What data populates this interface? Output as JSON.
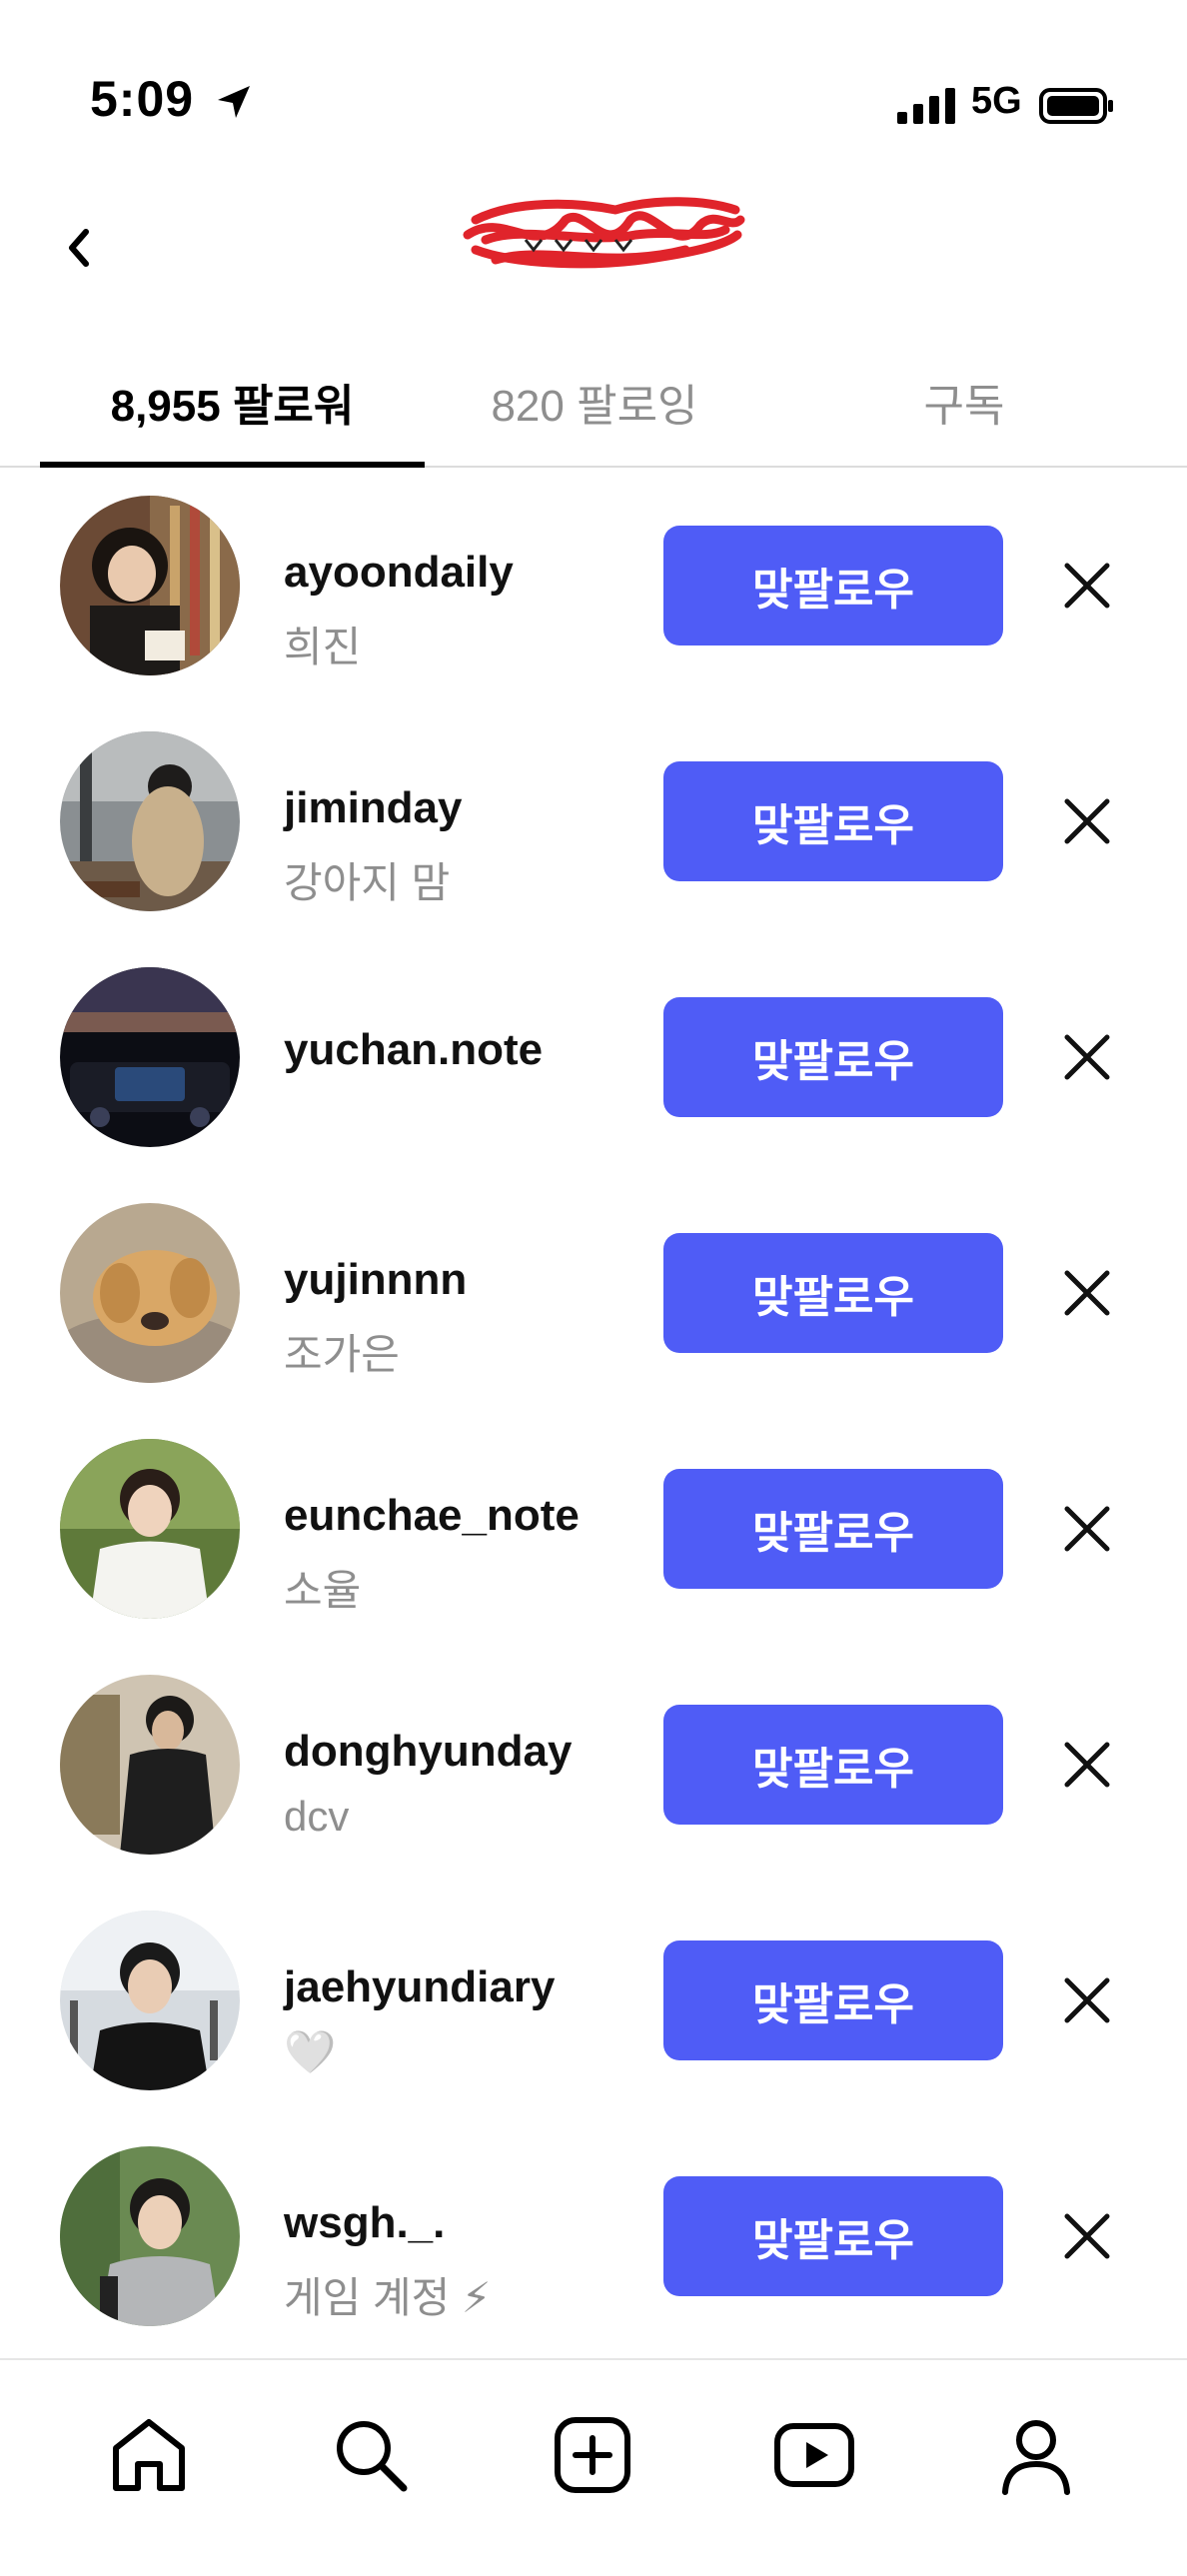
{
  "status_bar": {
    "time": "5:09",
    "network": "5G",
    "icons": [
      "location-arrow-icon",
      "signal-bars-icon",
      "battery-icon"
    ]
  },
  "header": {
    "back_icon": "chevron-left-icon",
    "title_redacted": true
  },
  "tabs": [
    {
      "label": "8,955 팔로워",
      "active": true
    },
    {
      "label": "820 팔로잉",
      "active": false
    },
    {
      "label": "구독",
      "active": false
    }
  ],
  "colors": {
    "accent": "#4f5cf6",
    "secondary_text": "#8e8e8e",
    "scribble": "#e0242b"
  },
  "followers": [
    {
      "username": "ayoondaily",
      "name": "희진",
      "button": "맞팔로우",
      "remove_icon": "close-icon"
    },
    {
      "username": "jiminday",
      "name": "강아지 맘",
      "button": "맞팔로우",
      "remove_icon": "close-icon"
    },
    {
      "username": "yuchan.note",
      "name": "",
      "button": "맞팔로우",
      "remove_icon": "close-icon"
    },
    {
      "username": "yujinnnn",
      "name": "조가은",
      "button": "맞팔로우",
      "remove_icon": "close-icon"
    },
    {
      "username": "eunchae_note",
      "name": "소율",
      "button": "맞팔로우",
      "remove_icon": "close-icon"
    },
    {
      "username": "donghyunday",
      "name": "dcv",
      "button": "맞팔로우",
      "remove_icon": "close-icon"
    },
    {
      "username": "jaehyundiary",
      "name": "🤍",
      "button": "맞팔로우",
      "remove_icon": "close-icon"
    },
    {
      "username": "wsgh._.",
      "name": "게임 계정 ⚡",
      "button": "맞팔로우",
      "remove_icon": "close-icon"
    }
  ],
  "bottom_nav": [
    "home-icon",
    "search-icon",
    "create-icon",
    "reels-icon",
    "profile-icon"
  ]
}
